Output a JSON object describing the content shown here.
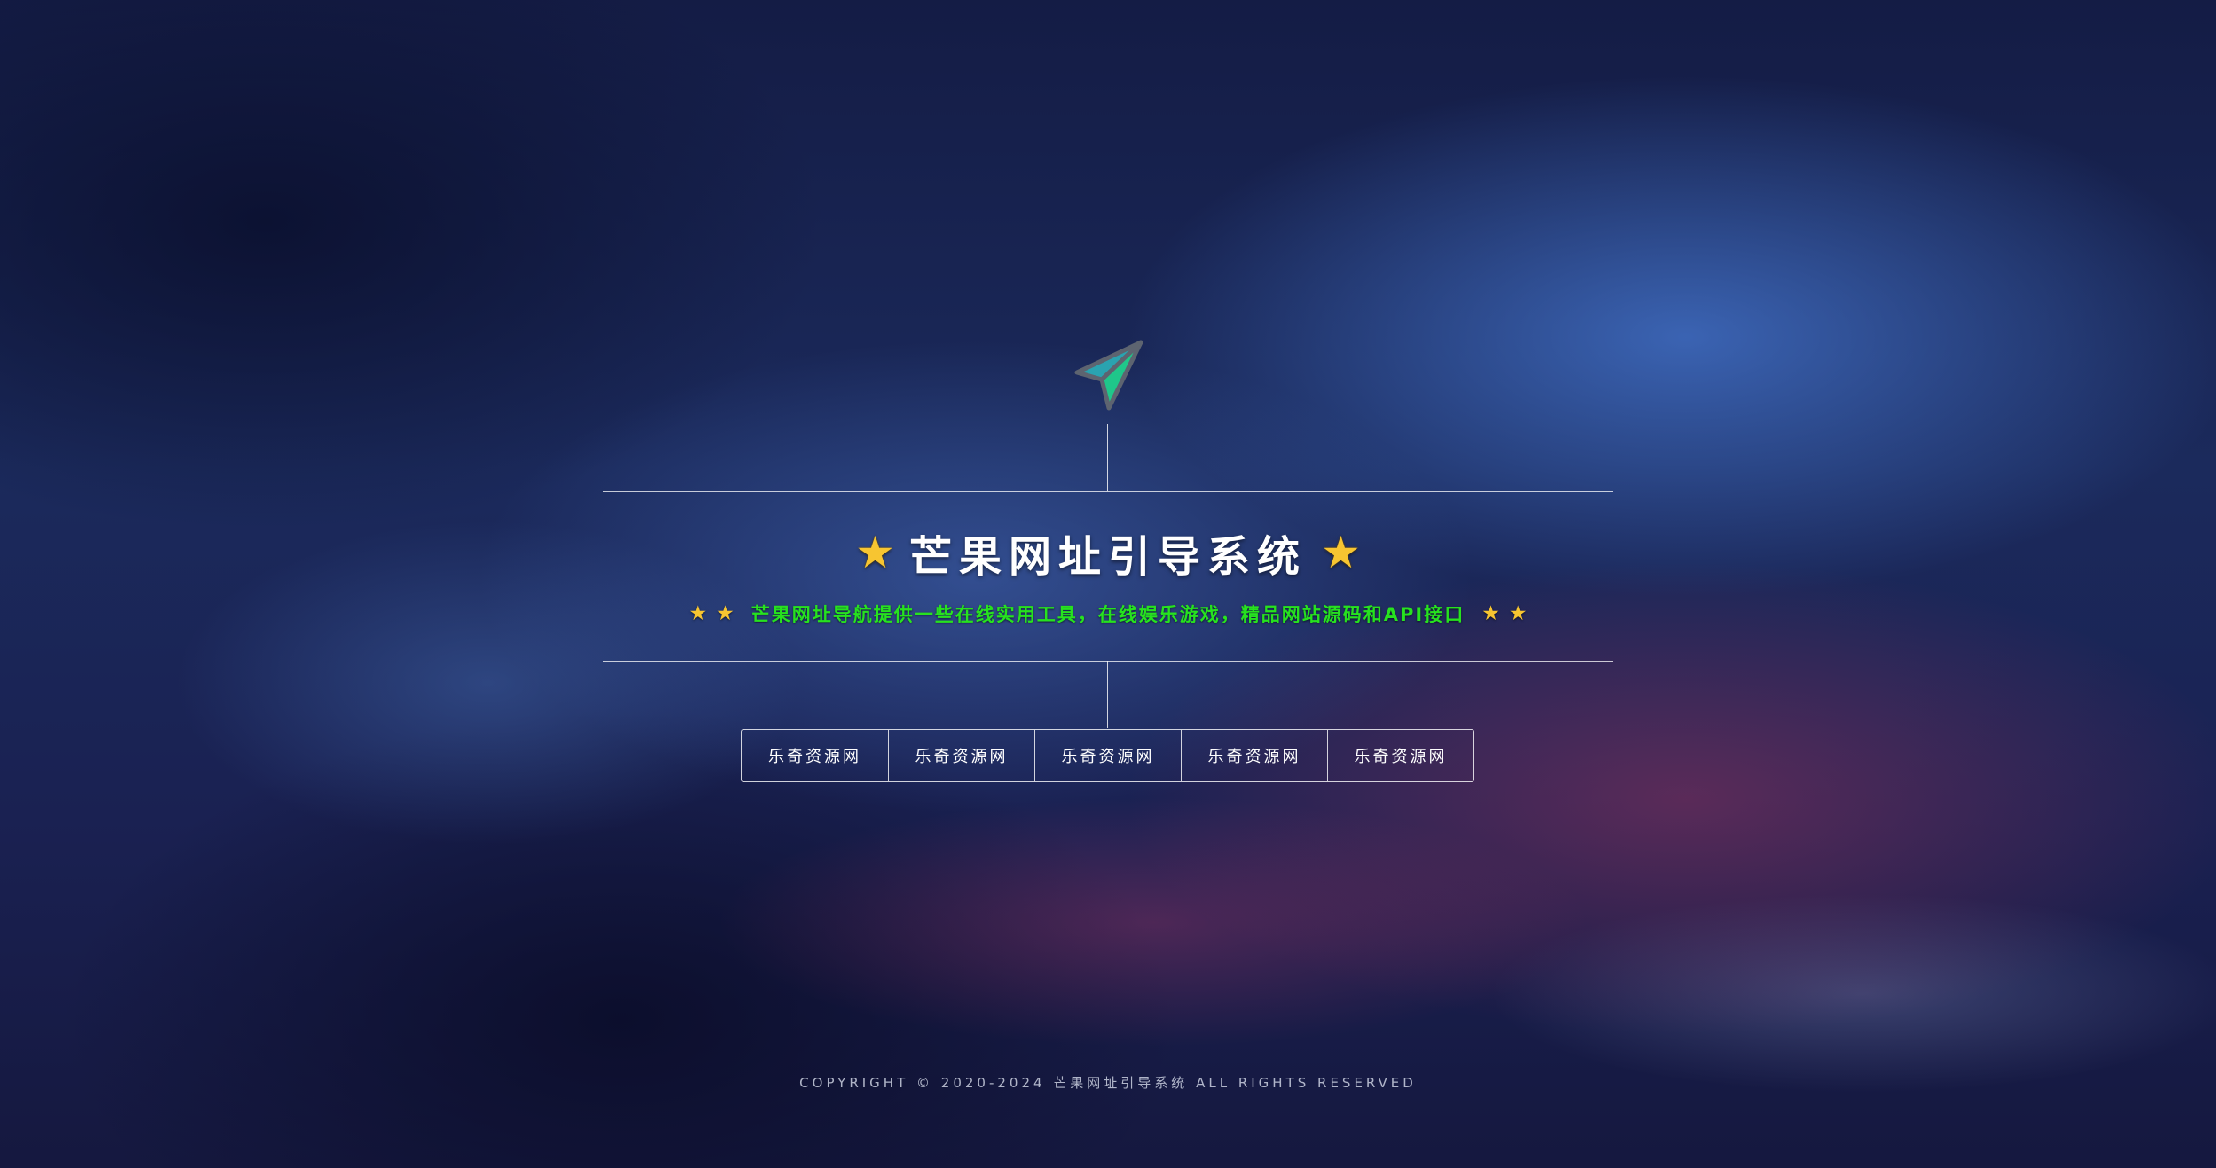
{
  "logo": {
    "icon": "paper-plane-icon",
    "colors": {
      "left": "#2aa3b0",
      "right": "#1fc78a",
      "outline": "#5d6470"
    }
  },
  "header": {
    "title": "芒果网址引导系统",
    "star_glyph": "★",
    "star_color": "#f7c531",
    "subtitle": "芒果网址导航提供一些在线实用工具，在线娱乐游戏，精品网站源码和API接口",
    "subtitle_color": "#27e21f"
  },
  "nav": {
    "items": [
      {
        "label": "乐奇资源网"
      },
      {
        "label": "乐奇资源网"
      },
      {
        "label": "乐奇资源网"
      },
      {
        "label": "乐奇资源网"
      },
      {
        "label": "乐奇资源网"
      }
    ]
  },
  "footer": {
    "copyright": "COPYRIGHT © 2020-2024 芒果网址引导系统 ALL RIGHTS RESERVED"
  }
}
